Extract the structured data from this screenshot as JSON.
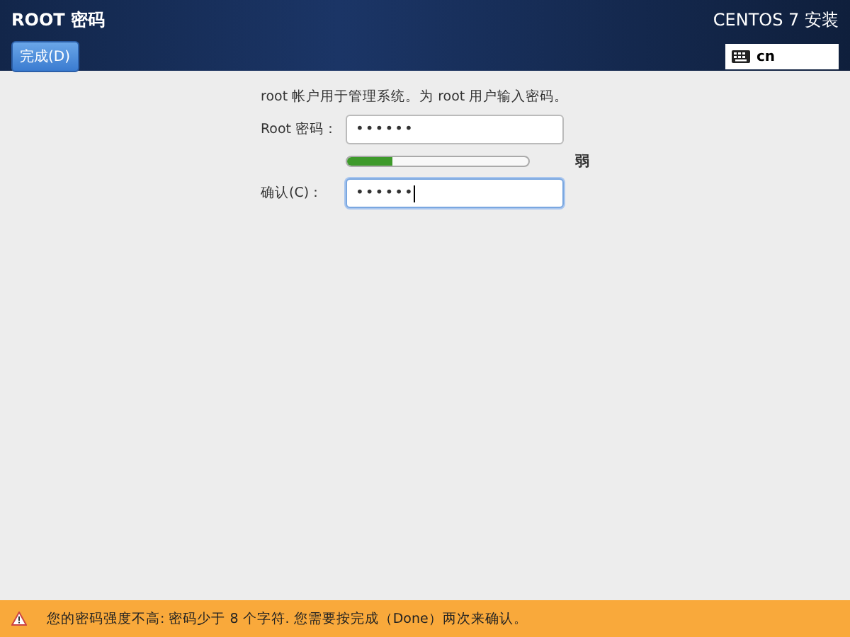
{
  "header": {
    "title": "ROOT 密码",
    "done_button": "完成(D)",
    "product": "CENTOS 7 安装",
    "keyboard": "cn"
  },
  "form": {
    "intro": "root 帐户用于管理系统。为 root 用户输入密码。",
    "fields": [
      {
        "label": "Root 密码：",
        "value": "••••••",
        "focused": false
      },
      {
        "label": "确认(C)：",
        "value": "••••••",
        "focused": true
      }
    ],
    "strength": {
      "level": 0.25,
      "reading": "弱"
    }
  },
  "status_bar": {
    "message": "您的密码强度不高: 密码少于 8 个字符. 您需要按完成（Done）两次来确认。"
  }
}
